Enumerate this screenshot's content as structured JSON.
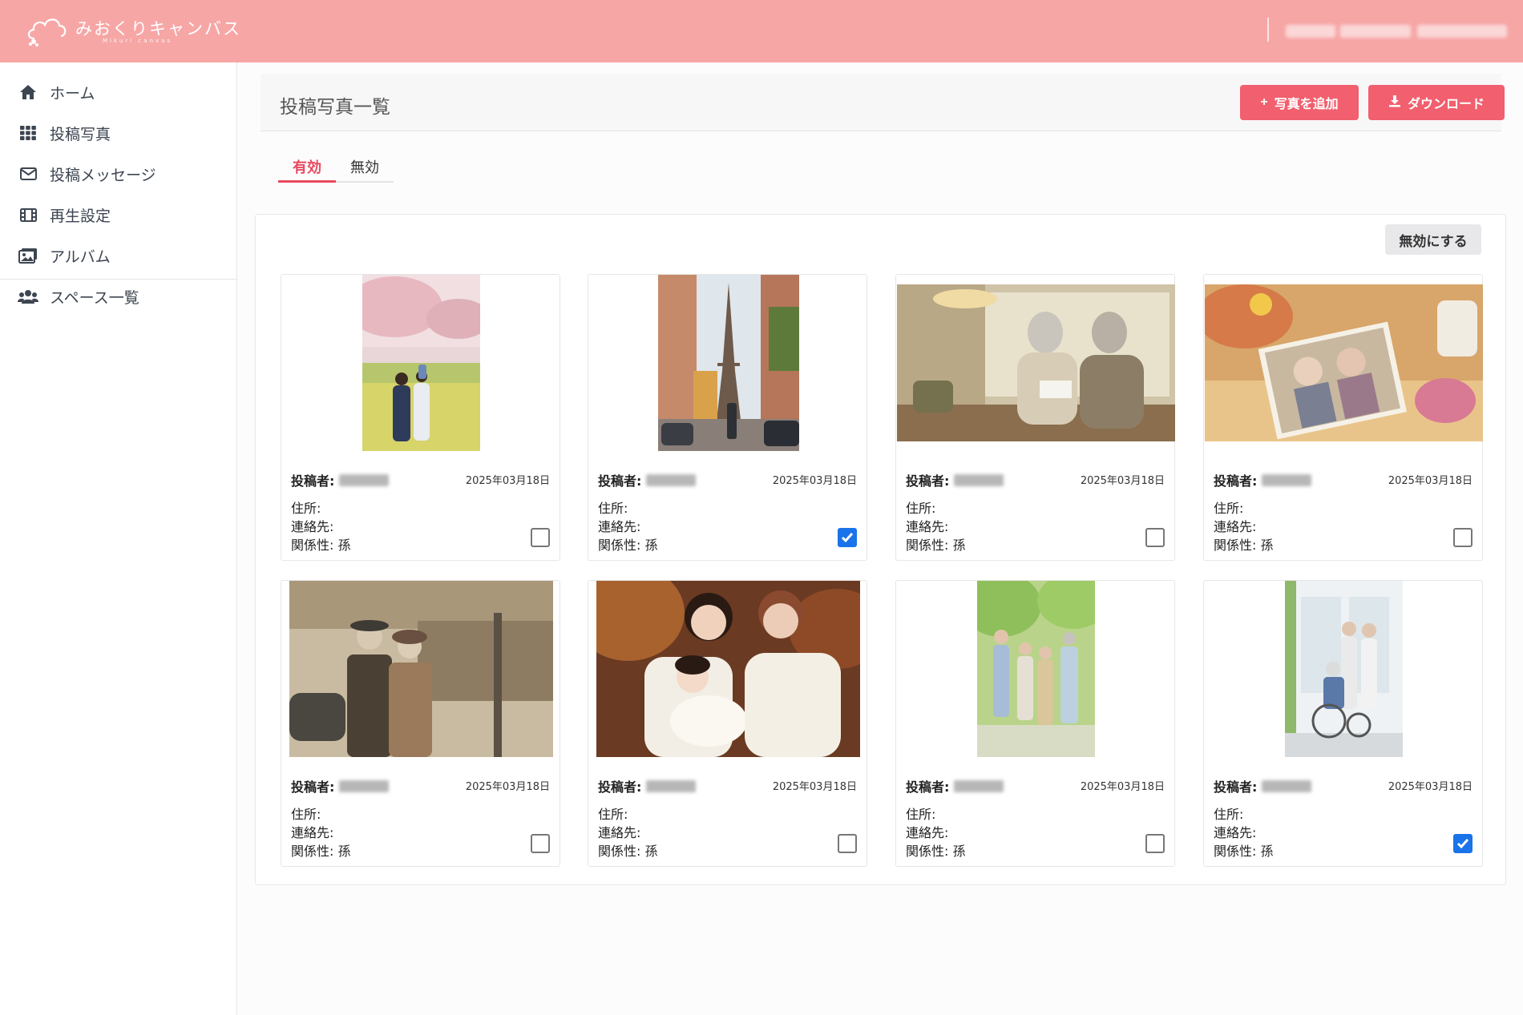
{
  "app": {
    "logo_text": "みおくりキャンバス",
    "logo_sub": "Mikuri canvas"
  },
  "sidebar": {
    "items": [
      {
        "label": "ホーム",
        "icon": "home-icon"
      },
      {
        "label": "投稿写真",
        "icon": "grid-icon"
      },
      {
        "label": "投稿メッセージ",
        "icon": "envelope-icon"
      },
      {
        "label": "再生設定",
        "icon": "film-icon"
      },
      {
        "label": "アルバム",
        "icon": "album-icon"
      },
      {
        "label": "スペース一覧",
        "icon": "users-icon"
      }
    ]
  },
  "page": {
    "title": "投稿写真一覧",
    "add_photo_label": "写真を追加",
    "download_label": "ダウンロード",
    "disable_label": "無効にする"
  },
  "tabs": [
    {
      "label": "有効",
      "active": true
    },
    {
      "label": "無効",
      "active": false
    }
  ],
  "colors": {
    "header": "#f7a6a6",
    "accent": "#f25f6e",
    "checkbox_checked": "#1a73e8"
  },
  "cards": [
    {
      "poster_label": "投稿者:",
      "date": "2025年03月18日",
      "address_label": "住所:",
      "contact_label": "連絡先:",
      "relation_label": "関係性: 孫",
      "checked": false,
      "photo": "cherry-blossom-family-photo"
    },
    {
      "poster_label": "投稿者:",
      "date": "2025年03月18日",
      "address_label": "住所:",
      "contact_label": "連絡先:",
      "relation_label": "関係性: 孫",
      "checked": true,
      "photo": "paris-eiffel-tower-photo"
    },
    {
      "poster_label": "投稿者:",
      "date": "2025年03月18日",
      "address_label": "住所:",
      "contact_label": "連絡先:",
      "relation_label": "関係性: 孫",
      "checked": false,
      "photo": "elderly-couple-reading-photo"
    },
    {
      "poster_label": "投稿者:",
      "date": "2025年03月18日",
      "address_label": "住所:",
      "contact_label": "連絡先:",
      "relation_label": "関係性: 孫",
      "checked": false,
      "photo": "framed-couple-portrait-photo"
    },
    {
      "poster_label": "投稿者:",
      "date": "2025年03月18日",
      "address_label": "住所:",
      "contact_label": "連絡先:",
      "relation_label": "関係性: 孫",
      "checked": false,
      "photo": "vintage-couple-street-photo"
    },
    {
      "poster_label": "投稿者:",
      "date": "2025年03月18日",
      "address_label": "住所:",
      "contact_label": "連絡先:",
      "relation_label": "関係性: 孫",
      "checked": false,
      "photo": "grandmother-baby-photo"
    },
    {
      "poster_label": "投稿者:",
      "date": "2025年03月18日",
      "address_label": "住所:",
      "contact_label": "連絡先:",
      "relation_label": "関係性: 孫",
      "checked": false,
      "photo": "family-group-garden-photo"
    },
    {
      "poster_label": "投稿者:",
      "date": "2025年03月18日",
      "address_label": "住所:",
      "contact_label": "連絡先:",
      "relation_label": "関係性: 孫",
      "checked": true,
      "photo": "wheelchair-family-photo"
    }
  ]
}
